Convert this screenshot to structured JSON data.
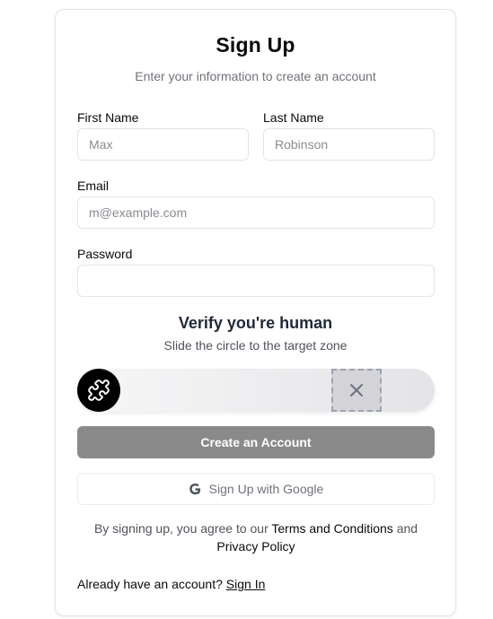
{
  "header": {
    "title": "Sign Up",
    "subtitle": "Enter your information to create an account"
  },
  "form": {
    "first_name": {
      "label": "First Name",
      "placeholder": "Max",
      "value": ""
    },
    "last_name": {
      "label": "Last Name",
      "placeholder": "Robinson",
      "value": ""
    },
    "email": {
      "label": "Email",
      "placeholder": "m@example.com",
      "value": ""
    },
    "password": {
      "label": "Password",
      "placeholder": "",
      "value": ""
    }
  },
  "captcha": {
    "title": "Verify you're human",
    "subtitle": "Slide the circle to the target zone",
    "handle_icon": "puzzle-icon",
    "target_icon": "close-icon",
    "progress": 0
  },
  "actions": {
    "create_label": "Create an Account",
    "google_label": "Sign Up with Google",
    "google_icon": "google-icon"
  },
  "terms": {
    "prefix": "By signing up, you agree to our",
    "terms_link": "Terms and Conditions",
    "conjunction": "and",
    "privacy_link": "Privacy Policy"
  },
  "footer": {
    "prompt": "Already have an account?",
    "signin_link": "Sign In"
  },
  "colors": {
    "primary_button": "#8a8a8a",
    "handle": "#000000",
    "muted_text": "#71717a",
    "border": "#e4e4e7"
  }
}
